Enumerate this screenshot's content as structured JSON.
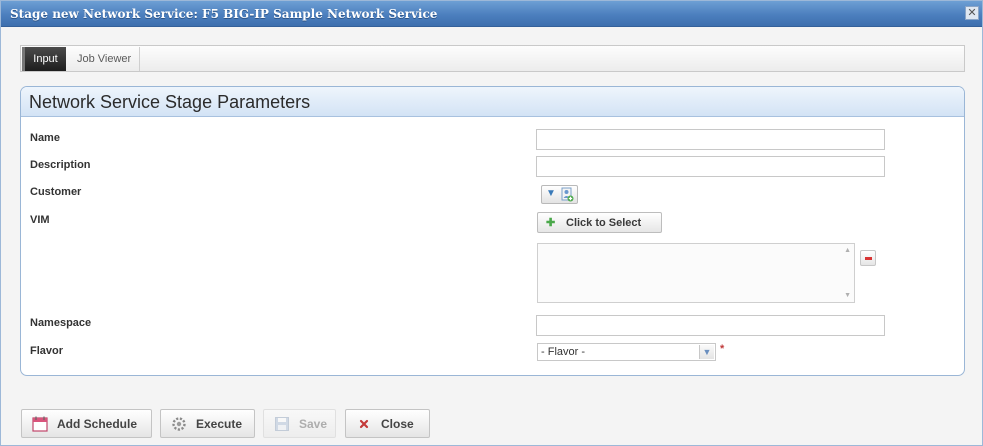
{
  "window": {
    "title": "Stage new Network Service: F5 BIG-IP Sample Network Service",
    "close_glyph": "✕"
  },
  "tabs": [
    {
      "label": "Input",
      "active": true
    },
    {
      "label": "Job Viewer",
      "active": false
    }
  ],
  "panel": {
    "title": "Network Service Stage Parameters"
  },
  "fields": {
    "name": {
      "label": "Name",
      "value": ""
    },
    "description": {
      "label": "Description",
      "value": ""
    },
    "customer": {
      "label": "Customer"
    },
    "vim": {
      "label": "VIM",
      "button_label": "Click to Select"
    },
    "namespace": {
      "label": "Namespace",
      "value": ""
    },
    "flavor": {
      "label": "Flavor",
      "selected": "- Flavor -",
      "required_marker": "*"
    }
  },
  "footer": {
    "add_schedule": "Add Schedule",
    "execute": "Execute",
    "save": "Save",
    "close": "Close"
  },
  "colors": {
    "titlebar": "#4c7fbe",
    "panel_border": "#9ab6d6",
    "active_tab": "#1e1e1e",
    "danger": "#d83434",
    "add": "#4aa84a"
  },
  "icons": {
    "customer_picker": "person-add-icon",
    "vim_add": "plus-icon",
    "remove": "minus-icon",
    "schedule": "calendar-icon",
    "execute": "gear-icon",
    "save": "disk-icon",
    "close": "x-icon"
  }
}
